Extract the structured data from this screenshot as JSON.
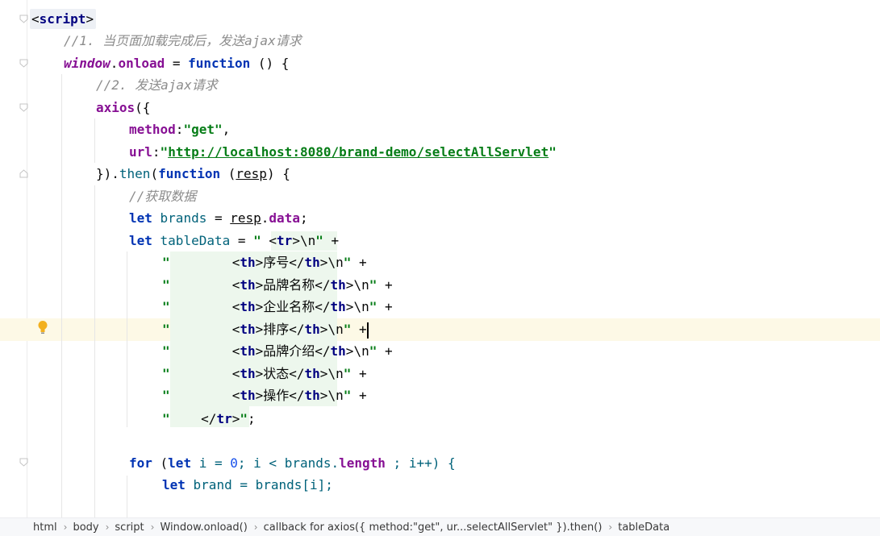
{
  "editor": {
    "lines": {
      "l1_open": "<",
      "l1_tag": "script",
      "l1_close": ">",
      "l2_comment": "//1. 当页面加载完成后，发送ajax请求",
      "l3_window": "window",
      "l3_dot": ".",
      "l3_onload": "onload",
      "l3_eq": " = ",
      "l3_function": "function",
      "l3_rest": " () {",
      "l4_comment": "//2. 发送ajax请求",
      "l5_axios": "axios",
      "l5_rest": "({",
      "l6_key": "method",
      "l6_colon": ":",
      "l6_val": "\"get\"",
      "l6_comma": ",",
      "l7_key": "url",
      "l7_colon": ":",
      "l7_quote1": "\"",
      "l7_url": "http://localhost:8080/brand-demo/selectAllServlet",
      "l7_quote2": "\"",
      "l8_start": "}).",
      "l8_then": "then",
      "l8_paren": "(",
      "l8_function": "function",
      "l8_sp": " (",
      "l8_resp": "resp",
      "l8_end": ") {",
      "l9_comment": "//获取数据",
      "l10_let": "let",
      "l10_brands": " brands",
      "l10_eq": " = ",
      "l10_resp": "resp",
      "l10_dot": ".",
      "l10_data": "data",
      "l10_semi": ";",
      "l11_let": "let",
      "l11_name": " tableData",
      "l11_eq": " = ",
      "l11_q": "\" ",
      "l11_lt": "<",
      "l11_tr": "tr",
      "l11_gt": ">",
      "l11_nl": "\\n",
      "l11_q2": "\"",
      "l11_plus": " +",
      "rows": [
        {
          "q": "\"",
          "pad": "        ",
          "lt": "<",
          "tag": "th",
          "gt": ">",
          "text": "序号",
          "clt": "</",
          "ctag": "th",
          "cgt": ">",
          "nl": "\\n",
          "q2": "\"",
          "plus": " +"
        },
        {
          "q": "\"",
          "pad": "        ",
          "lt": "<",
          "tag": "th",
          "gt": ">",
          "text": "品牌名称",
          "clt": "</",
          "ctag": "th",
          "cgt": ">",
          "nl": "\\n",
          "q2": "\"",
          "plus": " +"
        },
        {
          "q": "\"",
          "pad": "        ",
          "lt": "<",
          "tag": "th",
          "gt": ">",
          "text": "企业名称",
          "clt": "</",
          "ctag": "th",
          "cgt": ">",
          "nl": "\\n",
          "q2": "\"",
          "plus": " +"
        },
        {
          "q": "\"",
          "pad": "        ",
          "lt": "<",
          "tag": "th",
          "gt": ">",
          "text": "排序",
          "clt": "</",
          "ctag": "th",
          "cgt": ">",
          "nl": "\\n",
          "q2": "\"",
          "plus": " +"
        },
        {
          "q": "\"",
          "pad": "        ",
          "lt": "<",
          "tag": "th",
          "gt": ">",
          "text": "品牌介绍",
          "clt": "</",
          "ctag": "th",
          "cgt": ">",
          "nl": "\\n",
          "q2": "\"",
          "plus": " +"
        },
        {
          "q": "\"",
          "pad": "        ",
          "lt": "<",
          "tag": "th",
          "gt": ">",
          "text": "状态",
          "clt": "</",
          "ctag": "th",
          "cgt": ">",
          "nl": "\\n",
          "q2": "\"",
          "plus": " +"
        },
        {
          "q": "\"",
          "pad": "        ",
          "lt": "<",
          "tag": "th",
          "gt": ">",
          "text": "操作",
          "clt": "</",
          "ctag": "th",
          "cgt": ">",
          "nl": "\\n",
          "q2": "\"",
          "plus": " +"
        }
      ],
      "l19_q": "\"",
      "l19_pad": "    ",
      "l19_clt": "</",
      "l19_tr": "tr",
      "l19_gt": ">",
      "l19_q2": "\"",
      "l19_semi": ";",
      "l21_for": "for",
      "l21_p": " (",
      "l21_let": "let",
      "l21_i": " i = ",
      "l21_zero": "0",
      "l21_mid": "; i < brands.",
      "l21_length": "length",
      "l21_end": " ; i++) {",
      "l22_let": "let",
      "l22_rest": " brand = brands[i];"
    }
  },
  "statusbar": {
    "crumbs": [
      "html",
      "body",
      "script",
      "Window.onload()",
      "callback for axios({ method:\"get\", ur...selectAllServlet\" }).then()",
      "tableData"
    ]
  }
}
